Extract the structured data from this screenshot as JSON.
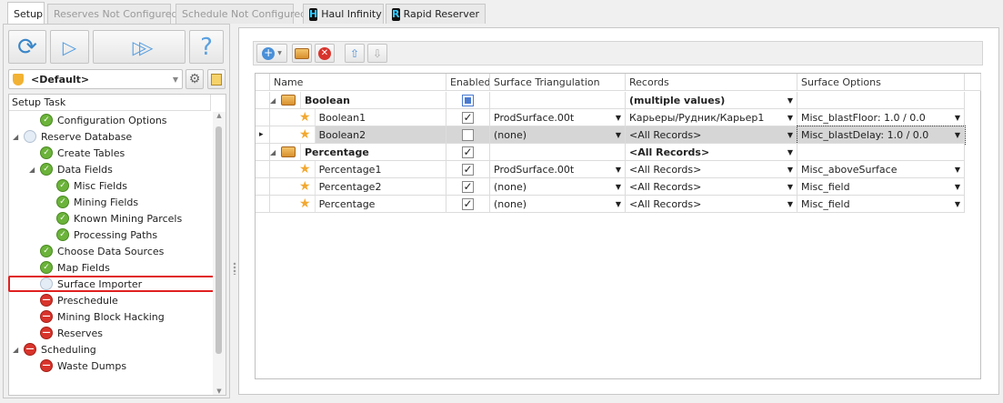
{
  "tabs": [
    {
      "label": "Setup",
      "active": true
    },
    {
      "label": "Reserves Not Configured"
    },
    {
      "label": "Schedule Not Configured"
    },
    {
      "label": "Haul Infinity",
      "icon": "H"
    },
    {
      "label": "Rapid Reserver",
      "icon": "R"
    }
  ],
  "left": {
    "profile": "<Default>",
    "tree_header": "Setup Task",
    "items": [
      {
        "label": "Configuration Options",
        "level": 1,
        "status": "ok"
      },
      {
        "label": "Reserve Database",
        "level": 0,
        "status": "none",
        "expand": true
      },
      {
        "label": "Create Tables",
        "level": 1,
        "status": "ok"
      },
      {
        "label": "Data Fields",
        "level": 1,
        "status": "ok",
        "expand": true
      },
      {
        "label": "Misc Fields",
        "level": 2,
        "status": "ok"
      },
      {
        "label": "Mining Fields",
        "level": 2,
        "status": "ok"
      },
      {
        "label": "Known Mining Parcels",
        "level": 2,
        "status": "ok"
      },
      {
        "label": "Processing Paths",
        "level": 2,
        "status": "ok"
      },
      {
        "label": "Choose Data Sources",
        "level": 1,
        "status": "ok"
      },
      {
        "label": "Map Fields",
        "level": 1,
        "status": "ok"
      },
      {
        "label": "Surface Importer",
        "level": 1,
        "status": "none",
        "highlighted": true
      },
      {
        "label": "Preschedule",
        "level": 1,
        "status": "err"
      },
      {
        "label": "Mining Block Hacking",
        "level": 1,
        "status": "err"
      },
      {
        "label": "Reserves",
        "level": 1,
        "status": "err"
      },
      {
        "label": "Scheduling",
        "level": 0,
        "status": "err",
        "expand": true
      },
      {
        "label": "Waste Dumps",
        "level": 1,
        "status": "err"
      }
    ]
  },
  "grid": {
    "columns": [
      "Name",
      "Enabled",
      "Surface Triangulation",
      "Records",
      "Surface Options"
    ],
    "rows": [
      {
        "name": "Boolean",
        "group": true,
        "enabled": "partial",
        "tri": "",
        "records": "(multiple values)",
        "options": ""
      },
      {
        "name": "Boolean1",
        "enabled": "checked",
        "tri": "ProdSurface.00t",
        "records": "Карьеры/Рудник/Карьер1",
        "options": "Misc_blastFloor: 1.0 / 0.0"
      },
      {
        "name": "Boolean2",
        "enabled": "unchecked",
        "tri": "(none)",
        "records": "<All Records>",
        "options": "Misc_blastDelay: 1.0 / 0.0",
        "selected": true
      },
      {
        "name": "Percentage",
        "group": true,
        "enabled": "checked",
        "tri": "",
        "records": "<All Records>",
        "options": ""
      },
      {
        "name": "Percentage1",
        "enabled": "checked",
        "tri": "ProdSurface.00t",
        "records": "<All Records>",
        "options": "Misc_aboveSurface"
      },
      {
        "name": "Percentage2",
        "enabled": "checked",
        "tri": "(none)",
        "records": "<All Records>",
        "options": "Misc_field"
      },
      {
        "name": "Percentage",
        "enabled": "checked",
        "tri": "(none)",
        "records": "<All Records>",
        "options": "Misc_field"
      }
    ]
  }
}
